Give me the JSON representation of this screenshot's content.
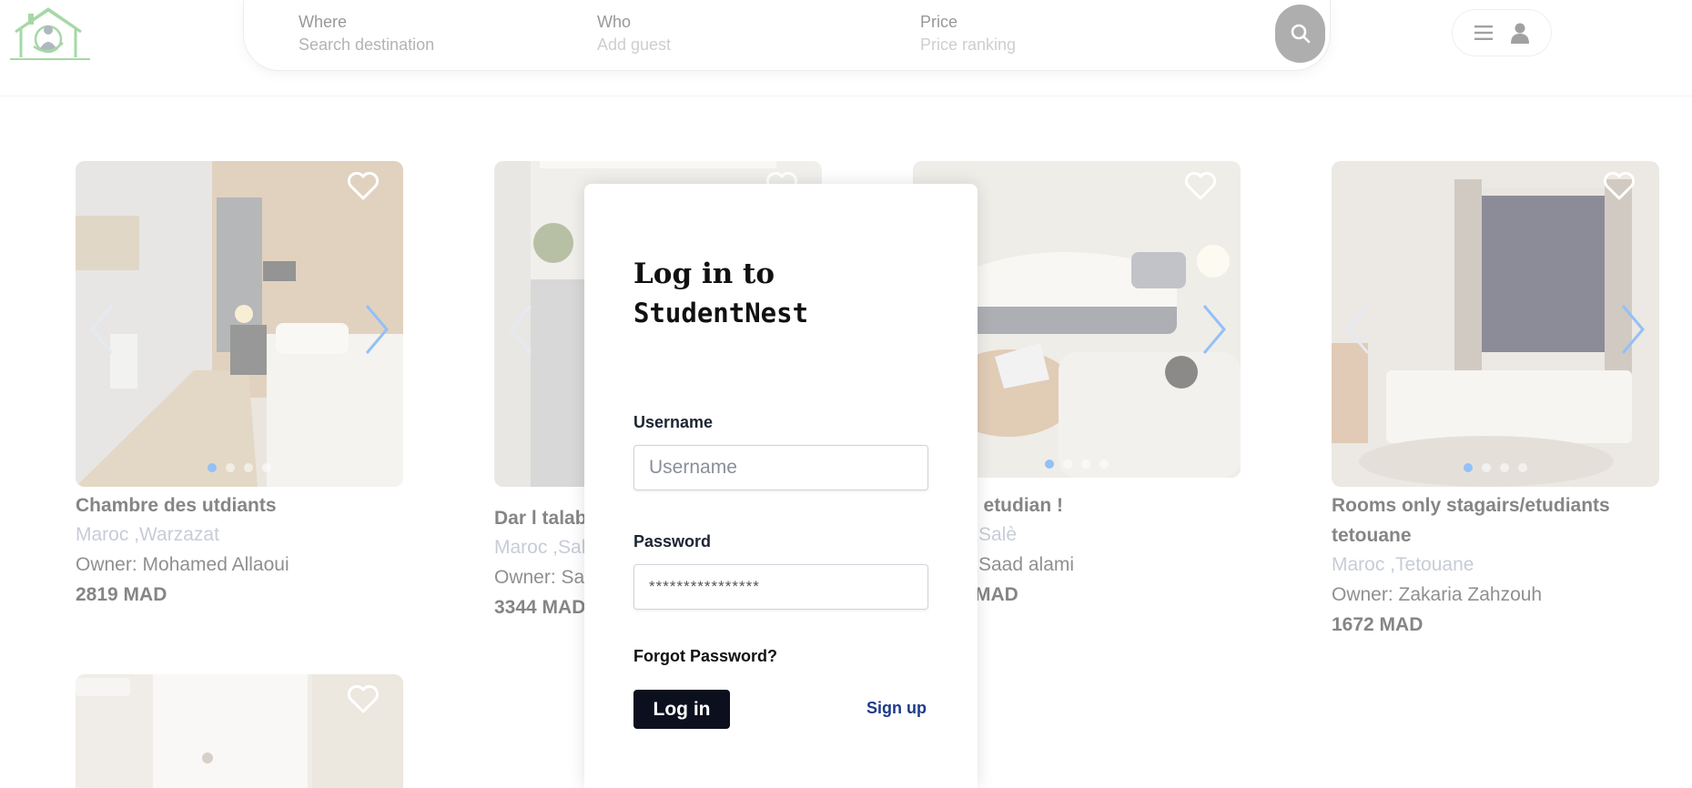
{
  "brand": {
    "logo_icon": "house-logo-icon",
    "colors": {
      "logo_green": "#5bb85d",
      "accent": "#3b8df0"
    }
  },
  "search": {
    "where_label": "Where",
    "where_placeholder": "Search destination",
    "who_label": "Who",
    "who_value": "Add guest",
    "price_label": "Price",
    "price_value": "Price ranking",
    "button_icon": "search-icon"
  },
  "user_menu": {
    "menu_icon": "hamburger-icon",
    "user_icon": "user-icon"
  },
  "listings": [
    {
      "title": "Chambre des utdiants",
      "location": "Maroc ,Warzazat",
      "owner": "Owner: Mohamed Allaoui",
      "price": "2819 MAD"
    },
    {
      "title": "Dar l talab",
      "location": "Maroc ,Sal",
      "owner": "Owner: Sa",
      "price": "3344 MAD"
    },
    {
      "title": "e etudian !",
      "location": "Salè",
      "owner": "Saad alami",
      "price": "MAD"
    },
    {
      "title": "Rooms only stagairs/etudiants tetouane",
      "location": "Maroc ,Tetouane",
      "owner": "Owner: Zakaria Zahzouh",
      "price": "1672 MAD"
    }
  ],
  "login": {
    "title_line1": "Log in to",
    "title_line2": "StudentNest",
    "username_label": "Username",
    "username_placeholder": "Username",
    "password_label": "Password",
    "password_value": "****************",
    "forgot_label": "Forgot Password?",
    "login_button": "Log in",
    "signup_link": "Sign up"
  }
}
